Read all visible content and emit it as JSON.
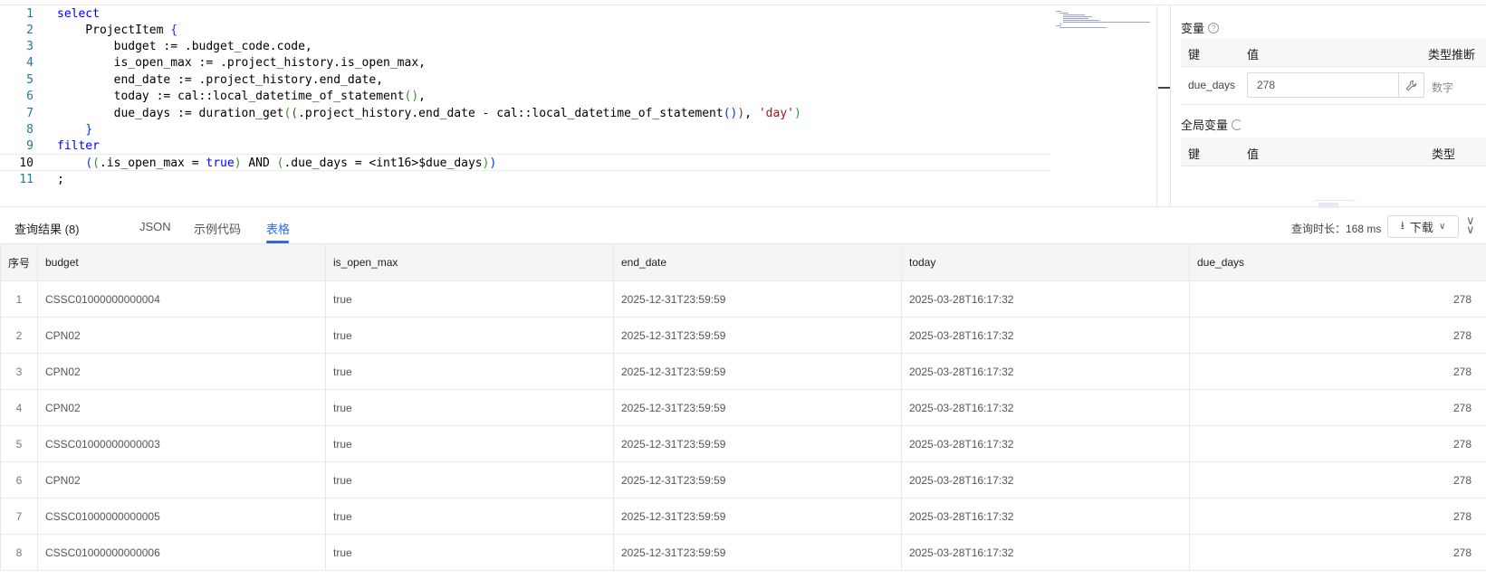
{
  "editor": {
    "lines": [
      {
        "n": "1"
      },
      {
        "n": "2"
      },
      {
        "n": "3"
      },
      {
        "n": "4"
      },
      {
        "n": "5"
      },
      {
        "n": "6"
      },
      {
        "n": "7"
      },
      {
        "n": "8"
      },
      {
        "n": "9"
      },
      {
        "n": "10"
      },
      {
        "n": "11"
      }
    ],
    "active_line": "10"
  },
  "variables": {
    "title": "变量",
    "headers": {
      "key": "键",
      "value": "值",
      "type": "类型推断"
    },
    "rows": [
      {
        "name": "due_days",
        "value": "278",
        "type": "数字"
      }
    ]
  },
  "global_variables": {
    "title": "全局变量",
    "headers": {
      "key": "键",
      "value": "值",
      "type": "类型"
    }
  },
  "results": {
    "title": "查询结果 (8)",
    "tabs": [
      "JSON",
      "示例代码",
      "表格"
    ],
    "active_tab": "表格",
    "query_time": "查询时长：168 ms",
    "download_label": "下载",
    "columns": [
      "序号",
      "budget",
      "is_open_max",
      "end_date",
      "today",
      "due_days"
    ],
    "rows": [
      [
        "1",
        "CSSC01000000000004",
        "true",
        "2025-12-31T23:59:59",
        "2025-03-28T16:17:32",
        "278"
      ],
      [
        "2",
        "CPN02",
        "true",
        "2025-12-31T23:59:59",
        "2025-03-28T16:17:32",
        "278"
      ],
      [
        "3",
        "CPN02",
        "true",
        "2025-12-31T23:59:59",
        "2025-03-28T16:17:32",
        "278"
      ],
      [
        "4",
        "CPN02",
        "true",
        "2025-12-31T23:59:59",
        "2025-03-28T16:17:32",
        "278"
      ],
      [
        "5",
        "CSSC01000000000003",
        "true",
        "2025-12-31T23:59:59",
        "2025-03-28T16:17:32",
        "278"
      ],
      [
        "6",
        "CPN02",
        "true",
        "2025-12-31T23:59:59",
        "2025-03-28T16:17:32",
        "278"
      ],
      [
        "7",
        "CSSC01000000000005",
        "true",
        "2025-12-31T23:59:59",
        "2025-03-28T16:17:32",
        "278"
      ],
      [
        "8",
        "CSSC01000000000006",
        "true",
        "2025-12-31T23:59:59",
        "2025-03-28T16:17:32",
        "278"
      ]
    ]
  },
  "icons": {
    "help": "question-circle-icon",
    "refresh": "refresh-icon",
    "wrench": "wrench-icon",
    "download": "download-icon",
    "chevron": "chevron-down-icon",
    "collapse": "double-chevron-down-icon"
  }
}
